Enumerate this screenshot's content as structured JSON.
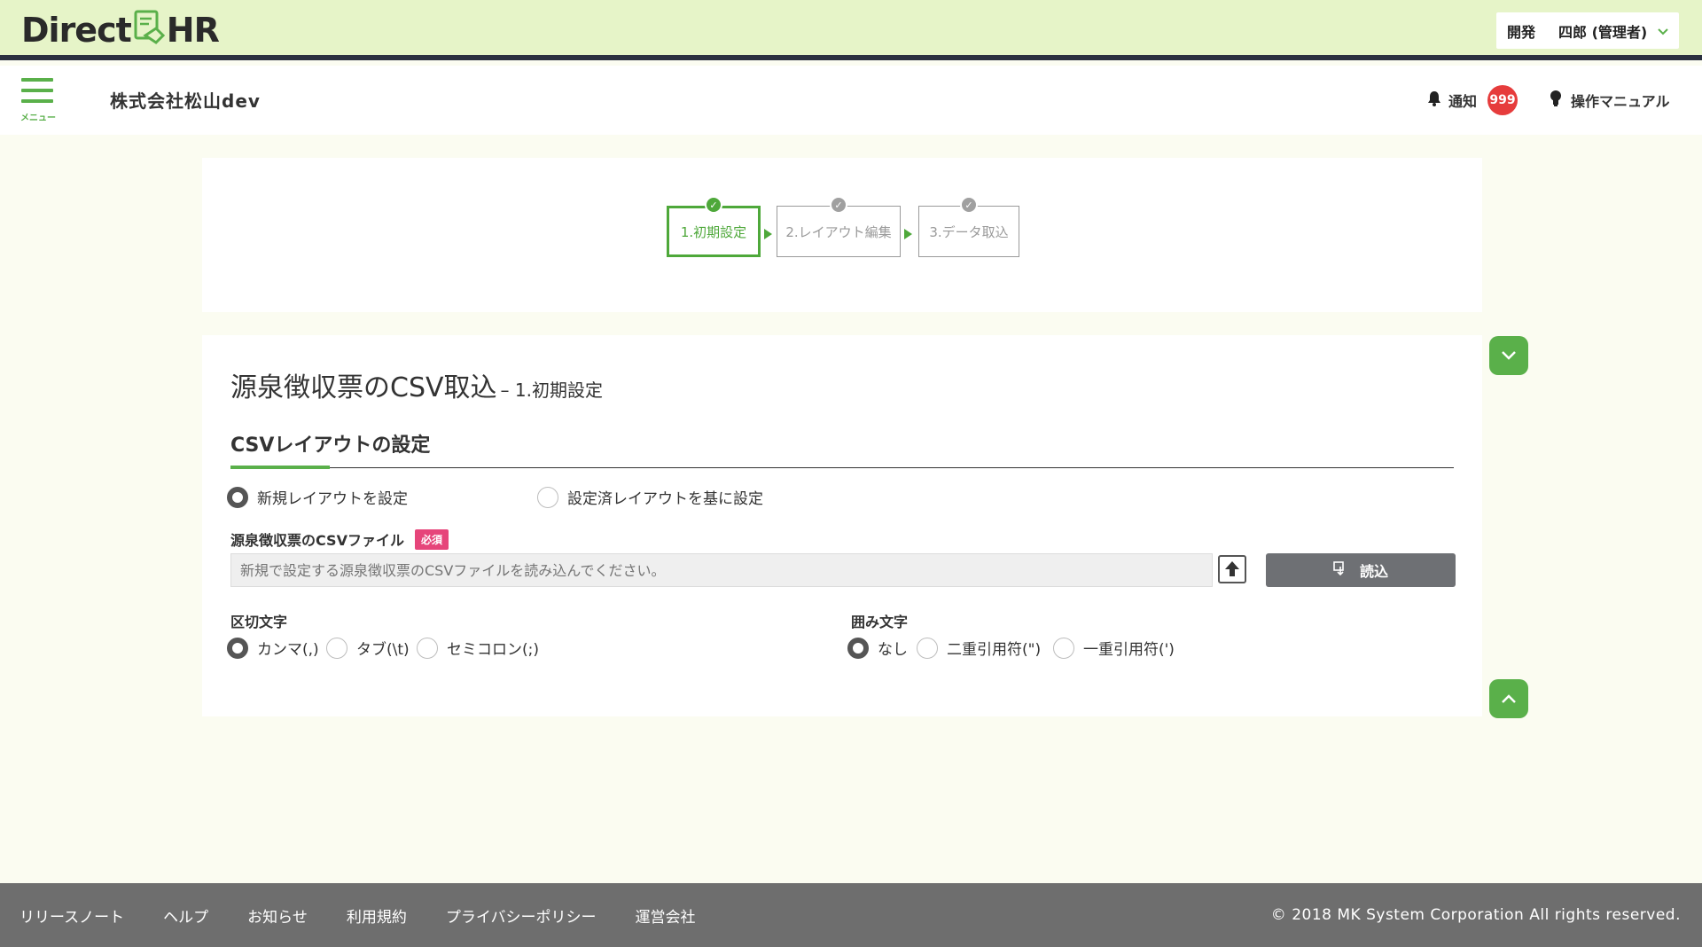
{
  "header": {
    "logo_left": "Direct",
    "logo_right": "HR",
    "user_dept": "開発",
    "user_name": "四郎 (管理者)"
  },
  "subheader": {
    "menu_label": "メニュー",
    "company": "株式会社松山dev",
    "notify_label": "通知",
    "notify_count": "999",
    "manual_label": "操作マニュアル"
  },
  "steps": [
    {
      "label": "1.初期設定",
      "active": true
    },
    {
      "label": "2.レイアウト編集",
      "active": false
    },
    {
      "label": "3.データ取込",
      "active": false
    }
  ],
  "main": {
    "title": "源泉徴収票のCSV取込",
    "subtitle": "– 1.初期設定",
    "section_title": "CSVレイアウトの設定",
    "layout_options": [
      "新規レイアウトを設定",
      "設定済レイアウトを基に設定"
    ],
    "file_label": "源泉徴収票のCSVファイル",
    "required_label": "必須",
    "file_placeholder": "新規で設定する源泉徴収票のCSVファイルを読み込んでください。",
    "read_button": "読込",
    "delimiter_label": "区切文字",
    "delimiter_options": [
      "カンマ(,)",
      "タブ(\\t)",
      "セミコロン(;)"
    ],
    "enclosure_label": "囲み文字",
    "enclosure_options": [
      "なし",
      "二重引用符(\")",
      "一重引用符(')"
    ]
  },
  "footer": {
    "links": [
      "リリースノート",
      "ヘルプ",
      "お知らせ",
      "利用規約",
      "プライバシーポリシー",
      "運営会社"
    ],
    "copyright": "© 2018 MK System Corporation All rights reserved."
  },
  "colors": {
    "accent": "#5ab04a",
    "header_bg": "#e6f4c8",
    "badge": "#e63c3c",
    "required": "#e6457a",
    "footer_bg": "#6e6e6e"
  }
}
